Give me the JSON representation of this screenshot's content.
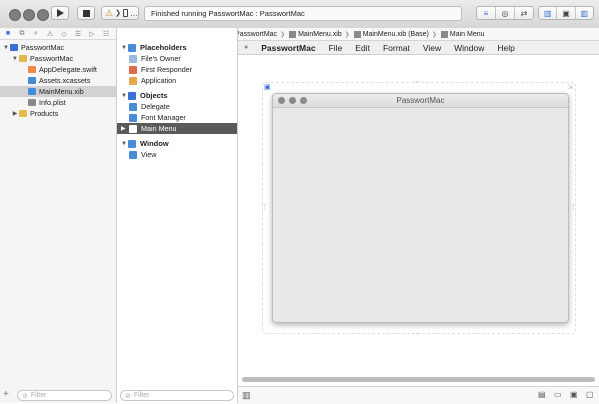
{
  "toolbar": {
    "status": "Finished running PasswortMac : PasswortMac",
    "scheme_target": "…"
  },
  "navigator": {
    "items": [
      {
        "label": "PasswortMac",
        "level": 0,
        "disc": "▼",
        "type": "project"
      },
      {
        "label": "PasswortMac",
        "level": 1,
        "disc": "▼",
        "type": "folder"
      },
      {
        "label": "AppDelegate.swift",
        "level": 2,
        "disc": "",
        "type": "swift"
      },
      {
        "label": "Assets.xcassets",
        "level": 2,
        "disc": "",
        "type": "assets"
      },
      {
        "label": "MainMenu.xib",
        "level": 2,
        "disc": "",
        "type": "xib"
      },
      {
        "label": "Info.plist",
        "level": 2,
        "disc": "",
        "type": "plist"
      },
      {
        "label": "Products",
        "level": 1,
        "disc": "▶",
        "type": "folder"
      }
    ],
    "filter_placeholder": "Filter"
  },
  "outline": {
    "placeholders_heading": "Placeholders",
    "placeholders": [
      "File's Owner",
      "First Responder",
      "Application"
    ],
    "objects_heading": "Objects",
    "objects": [
      "Delegate",
      "Font Manager",
      "Main Menu"
    ],
    "window_heading": "Window",
    "window_children": [
      "View"
    ],
    "filter_placeholder": "Filter"
  },
  "jumpbar": {
    "crumbs": [
      "PasswortMac",
      "PasswortMac",
      "MainMenu.xib",
      "MainMenu.xib (Base)",
      "Main Menu"
    ]
  },
  "menubar": {
    "app_name": "PasswortMac",
    "items": [
      "File",
      "Edit",
      "Format",
      "View",
      "Window",
      "Help"
    ]
  },
  "canvas": {
    "window_title": "PasswortMac"
  },
  "colors": {
    "accent": "#3a6fd8",
    "selected_outline": "#5a5a5a",
    "selected_nav": "#d2d2d2"
  }
}
